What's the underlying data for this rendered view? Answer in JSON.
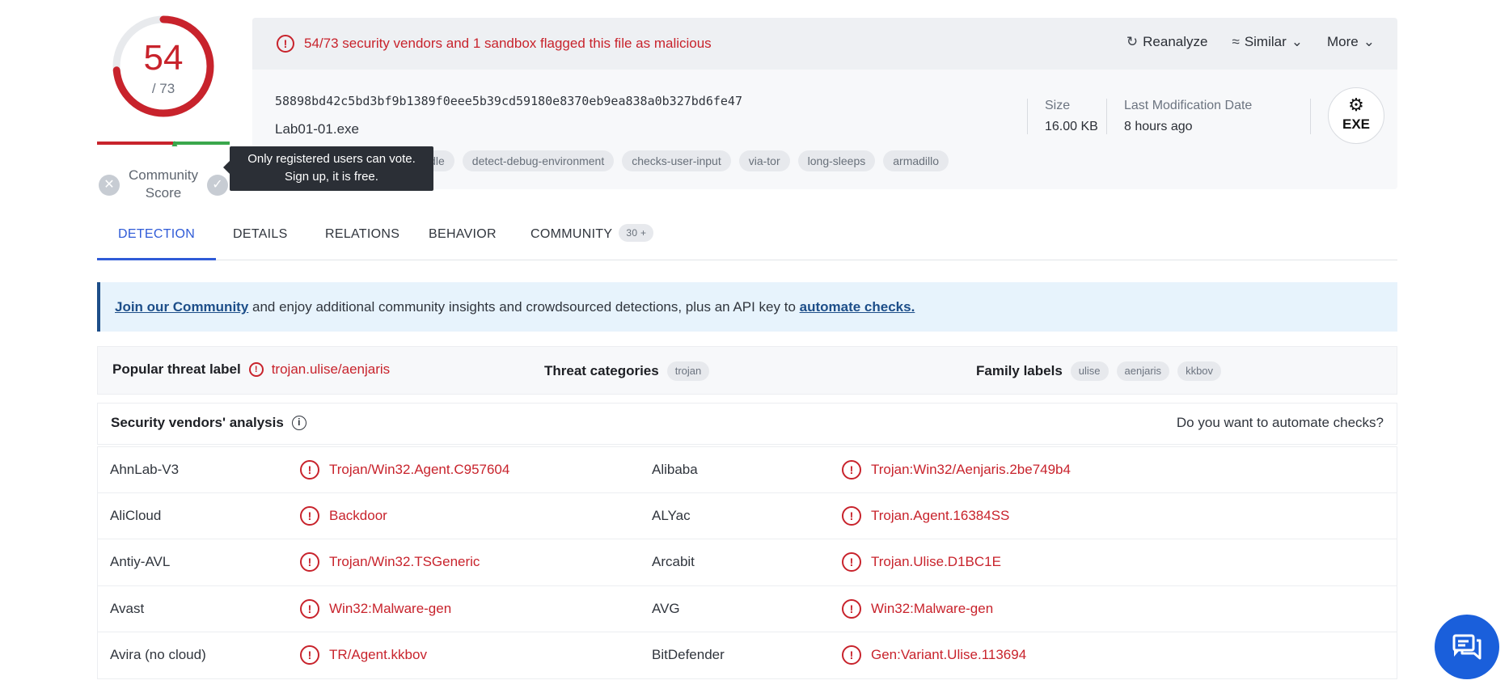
{
  "score": {
    "detections": "54",
    "total": "/ 73",
    "community_label": "Community Score",
    "tooltip": "Only registered users can vote. Sign up, it is free."
  },
  "file": {
    "alert": "54/73 security vendors and 1 sandbox flagged this file as malicious",
    "actions": {
      "reanalyze": "Reanalyze",
      "similar": "Similar",
      "more": "More"
    },
    "hash": "58898bd42c5bd3bf9b1389f0eee5b39cd59180e8370eb9ea838a0b327bd6fe47",
    "name": "Lab01-01.exe",
    "tags": [
      "idle",
      "detect-debug-environment",
      "checks-user-input",
      "via-tor",
      "long-sleeps",
      "armadillo"
    ],
    "size_label": "Size",
    "size_value": "16.00 KB",
    "mod_label": "Last Modification Date",
    "mod_value": "8 hours ago",
    "type_badge": "EXE"
  },
  "tabs": [
    {
      "label": "DETECTION"
    },
    {
      "label": "DETAILS"
    },
    {
      "label": "RELATIONS"
    },
    {
      "label": "BEHAVIOR"
    },
    {
      "label": "COMMUNITY",
      "badge": "30 +"
    }
  ],
  "banner": {
    "link1": "Join our Community",
    "text": " and enjoy additional community insights and crowdsourced detections, plus an API key to ",
    "link2": "automate checks."
  },
  "threat": {
    "popular_label": "Popular threat label",
    "popular_value": "trojan.ulise/aenjaris",
    "categories_label": "Threat categories",
    "categories": [
      "trojan"
    ],
    "family_label": "Family labels",
    "families": [
      "ulise",
      "aenjaris",
      "kkbov"
    ]
  },
  "vendors": {
    "title": "Security vendors' analysis",
    "automate_q": "Do you want to automate checks?",
    "rows": [
      {
        "v1": "AhnLab-V3",
        "r1": "Trojan/Win32.Agent.C957604",
        "v2": "Alibaba",
        "r2": "Trojan:Win32/Aenjaris.2be749b4"
      },
      {
        "v1": "AliCloud",
        "r1": "Backdoor",
        "v2": "ALYac",
        "r2": "Trojan.Agent.16384SS"
      },
      {
        "v1": "Antiy-AVL",
        "r1": "Trojan/Win32.TSGeneric",
        "v2": "Arcabit",
        "r2": "Trojan.Ulise.D1BC1E"
      },
      {
        "v1": "Avast",
        "r1": "Win32:Malware-gen",
        "v2": "AVG",
        "r2": "Win32:Malware-gen"
      },
      {
        "v1": "Avira (no cloud)",
        "r1": "TR/Agent.kkbov",
        "v2": "BitDefender",
        "r2": "Gen:Variant.Ulise.113694"
      }
    ]
  },
  "colors": {
    "malicious": "#c8232c",
    "accent": "#2f5bd7",
    "banner_border": "#1d4e89",
    "fab": "#1a5fdb"
  }
}
